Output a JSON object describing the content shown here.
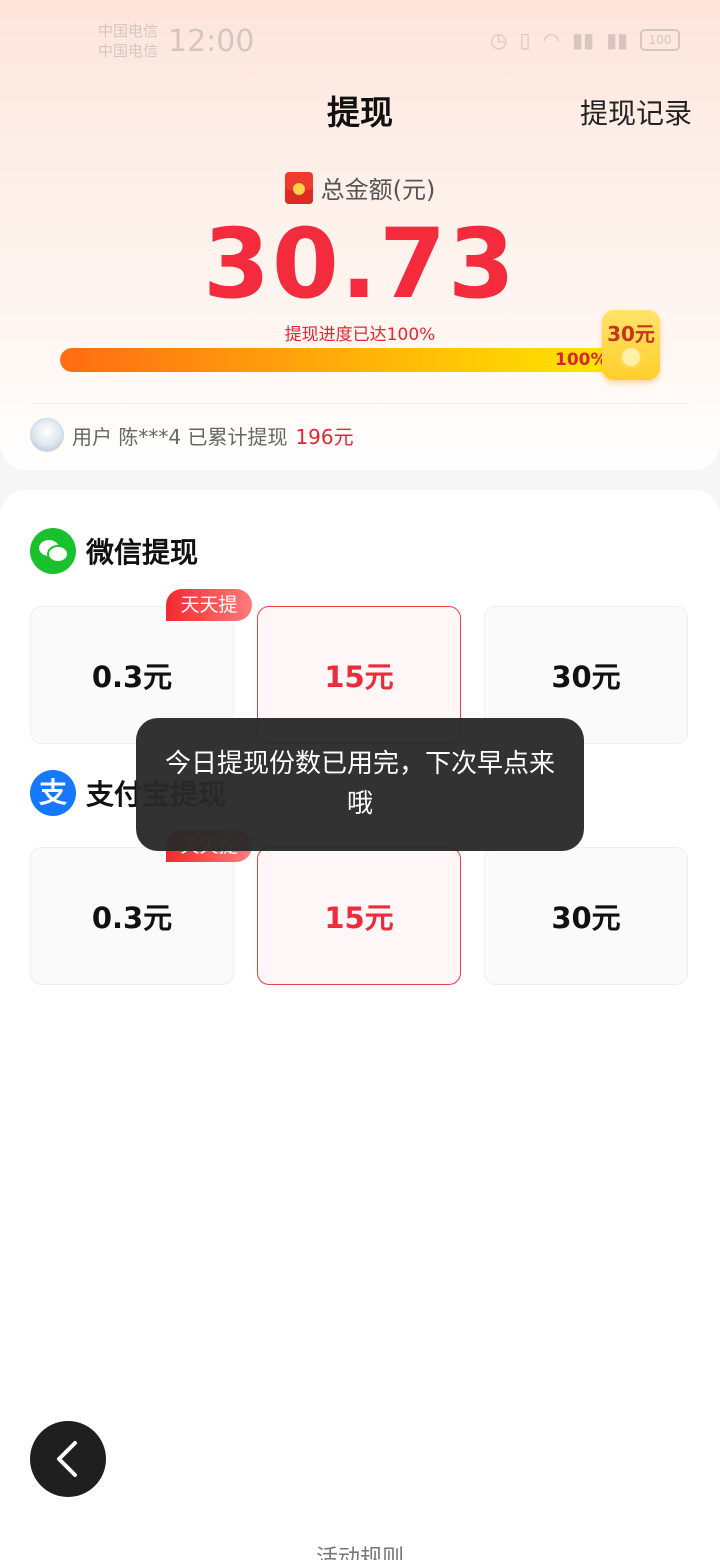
{
  "status_bar": {
    "carrier_1": "中国电信",
    "carrier_2": "中国电信",
    "time": "12:00",
    "battery": "100"
  },
  "header": {
    "title": "提现",
    "record_link": "提现记录"
  },
  "summary": {
    "total_label": "总金额(元)",
    "total_amount": "30.73",
    "progress_text": "提现进度已达100%",
    "progress_fraction": 1.0,
    "progress_label": "100%",
    "goal_badge": "30元"
  },
  "ticker": {
    "text": "用户 陈***4 已累计提现",
    "amount": "196元"
  },
  "wechat": {
    "title": "微信提现",
    "tag": "天天提",
    "options": [
      "0.3元",
      "15元",
      "30元"
    ],
    "selected_index": 1
  },
  "alipay": {
    "title": "支付宝提现",
    "icon_glyph": "支",
    "tag": "天天提",
    "options": [
      "0.3元",
      "15元",
      "30元"
    ],
    "selected_index": 1
  },
  "toast": {
    "message": "今日提现份数已用完，下次早点来哦"
  },
  "footer": {
    "rules_link": "活动规则"
  },
  "colors": {
    "accent_red": "#f42a3d",
    "wechat_green": "#19c22d",
    "alipay_blue": "#1677ff"
  }
}
